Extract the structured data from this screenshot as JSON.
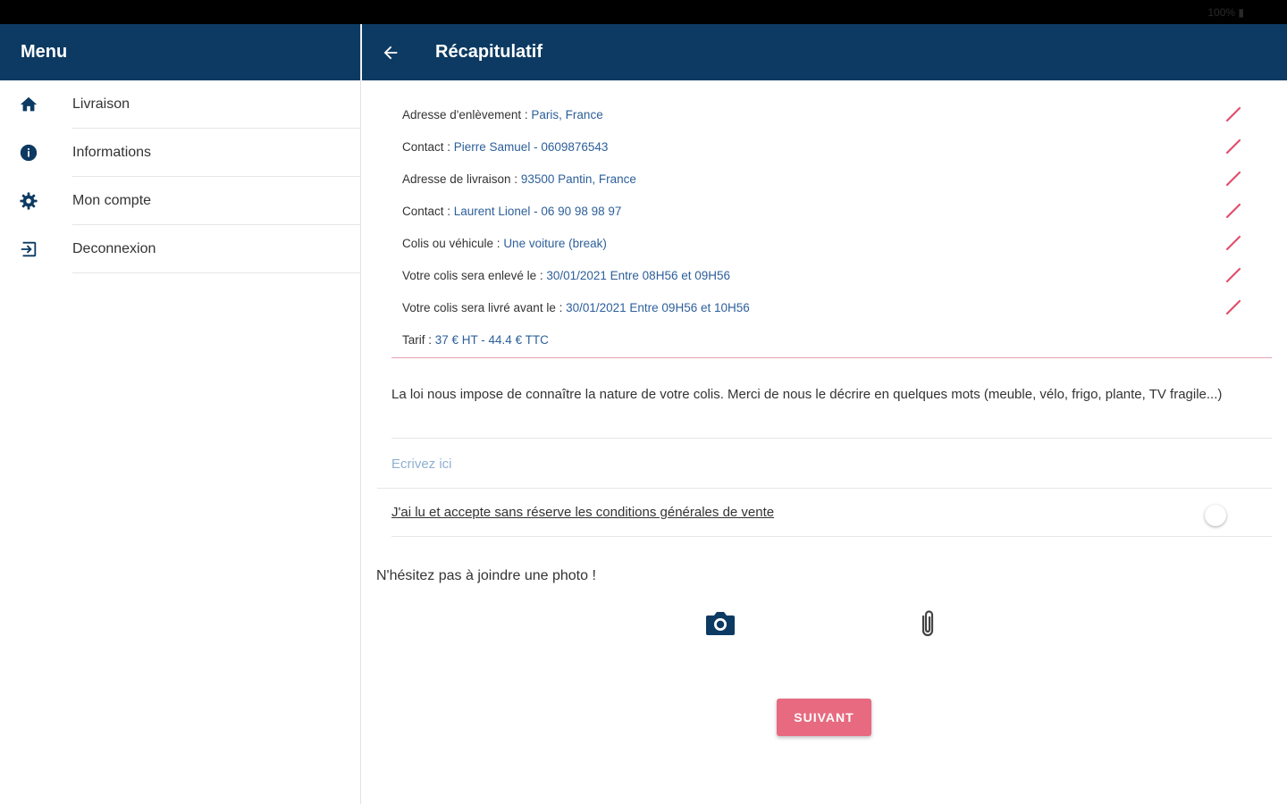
{
  "status_bar": {
    "text": "100% ▮"
  },
  "menu": {
    "title": "Menu",
    "items": [
      {
        "icon": "home-icon",
        "label": "Livraison"
      },
      {
        "icon": "info-icon",
        "label": "Informations"
      },
      {
        "icon": "gear-icon",
        "label": "Mon compte"
      },
      {
        "icon": "logout-icon",
        "label": "Deconnexion"
      }
    ]
  },
  "header": {
    "title": "Récapitulatif",
    "back_icon": "arrow-left-icon"
  },
  "recap": {
    "rows": [
      {
        "label": "Adresse d'enlèvement : ",
        "value": "Paris, France",
        "editable": true
      },
      {
        "label": "Contact : ",
        "value": "Pierre Samuel - 0609876543",
        "editable": true
      },
      {
        "label": "Adresse de livraison : ",
        "value": "93500 Pantin, France",
        "editable": true
      },
      {
        "label": "Contact : ",
        "value": "Laurent Lionel - 06 90 98 98 97",
        "editable": true
      },
      {
        "label": "Colis ou véhicule : ",
        "value": "Une voiture (break)",
        "editable": true
      },
      {
        "label": "Votre colis sera enlevé le : ",
        "value": "30/01/2021 Entre 08H56 et 09H56",
        "editable": true
      },
      {
        "label": "Votre colis sera livré avant le : ",
        "value": "30/01/2021 Entre 09H56 et 10H56",
        "editable": true
      },
      {
        "label": "Tarif : ",
        "value": "37 € HT - 44.4 € TTC",
        "editable": false
      }
    ]
  },
  "description": {
    "law_text": "La loi nous impose de connaître la nature de votre colis. Merci de nous le décrire en quelques mots (meuble, vélo, frigo, plante, TV fragile...)",
    "placeholder": "Ecrivez ici",
    "value": ""
  },
  "cgv": {
    "label": "J'ai lu et accepte sans réserve les conditions générales de vente",
    "checked": false
  },
  "photo": {
    "hint": "N'hésitez pas à joindre une photo !",
    "camera_icon": "camera-icon",
    "attach_icon": "paperclip-icon"
  },
  "actions": {
    "next_label": "SUIVANT"
  },
  "colors": {
    "primary": "#0c3a62",
    "accent": "#e76a80",
    "value_text": "#2d5f9a",
    "edit_icon": "#e0506e"
  }
}
